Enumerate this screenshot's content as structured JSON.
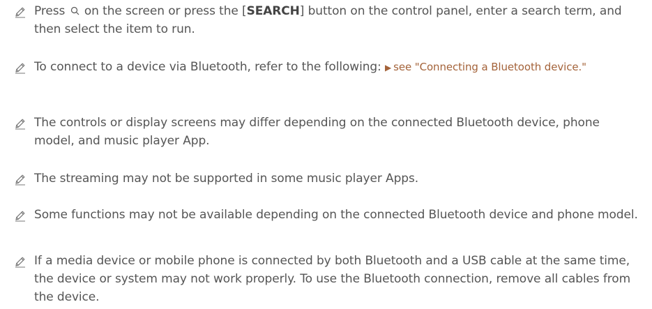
{
  "notes": [
    {
      "before": "Press ",
      "icon": "search-icon",
      "middle": " on the screen or press the [",
      "button": "SEARCH",
      "after": "] button on the control panel, enter a search term, and then select the item to run."
    },
    {
      "text": "To connect to a device via Bluetooth, refer to the following: ",
      "link_arrow": "▶",
      "link": "see \"Connecting a Bluetooth device.\""
    },
    {
      "text": "The controls or display screens may differ depending on the connected Bluetooth device, phone model, and music player App."
    },
    {
      "text": "The streaming may not be supported in some music player Apps."
    },
    {
      "text": "Some functions may not be available depending on the connected Bluetooth device and phone model."
    },
    {
      "text": "If a media device or mobile phone is connected by both Bluetooth and a USB cable at the same time, the device or system may not work properly. To use the Bluetooth connection, remove all cables from the device."
    }
  ],
  "icons": {
    "note": "pencil-icon",
    "inline": "search-icon"
  },
  "colors": {
    "text": "#555555",
    "link": "#a4633a",
    "icon": "#777777"
  }
}
